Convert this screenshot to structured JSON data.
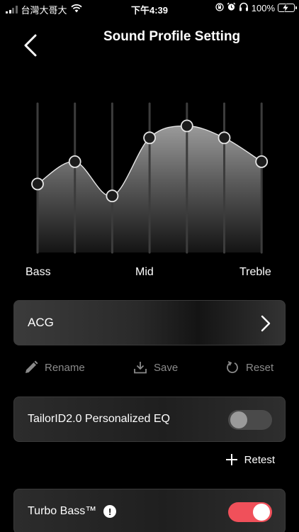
{
  "status_bar": {
    "carrier": "台灣大哥大",
    "time": "下午4:39",
    "battery_percent": "100%",
    "signal_bars_filled": 2,
    "signal_bars_total": 4,
    "icons": [
      "signal-icon",
      "wifi-icon",
      "rotation-lock-icon",
      "alarm-icon",
      "headphones-icon",
      "battery-charging-icon"
    ]
  },
  "header": {
    "back_icon": "chevron-left-icon",
    "title": "Sound Profile Setting"
  },
  "eq": {
    "band_count": 7,
    "levels": [
      0.46,
      0.61,
      0.38,
      0.77,
      0.85,
      0.77,
      0.61
    ],
    "labels": {
      "low": "Bass",
      "mid": "Mid",
      "high": "Treble"
    }
  },
  "preset": {
    "name": "ACG",
    "icon": "chevron-right-icon"
  },
  "actions": {
    "rename": "Rename",
    "save": "Save",
    "reset": "Reset"
  },
  "personalized_eq": {
    "label": "TailorID2.0 Personalized EQ",
    "enabled": false,
    "retest_label": "Retest"
  },
  "turbo_bass": {
    "label": "Turbo Bass™",
    "enabled": true,
    "info_icon": "info-icon"
  },
  "colors": {
    "background": "#000000",
    "accent_on": "#f0505a",
    "muted_text": "#8a8a8a",
    "battery": "#4cd964"
  }
}
